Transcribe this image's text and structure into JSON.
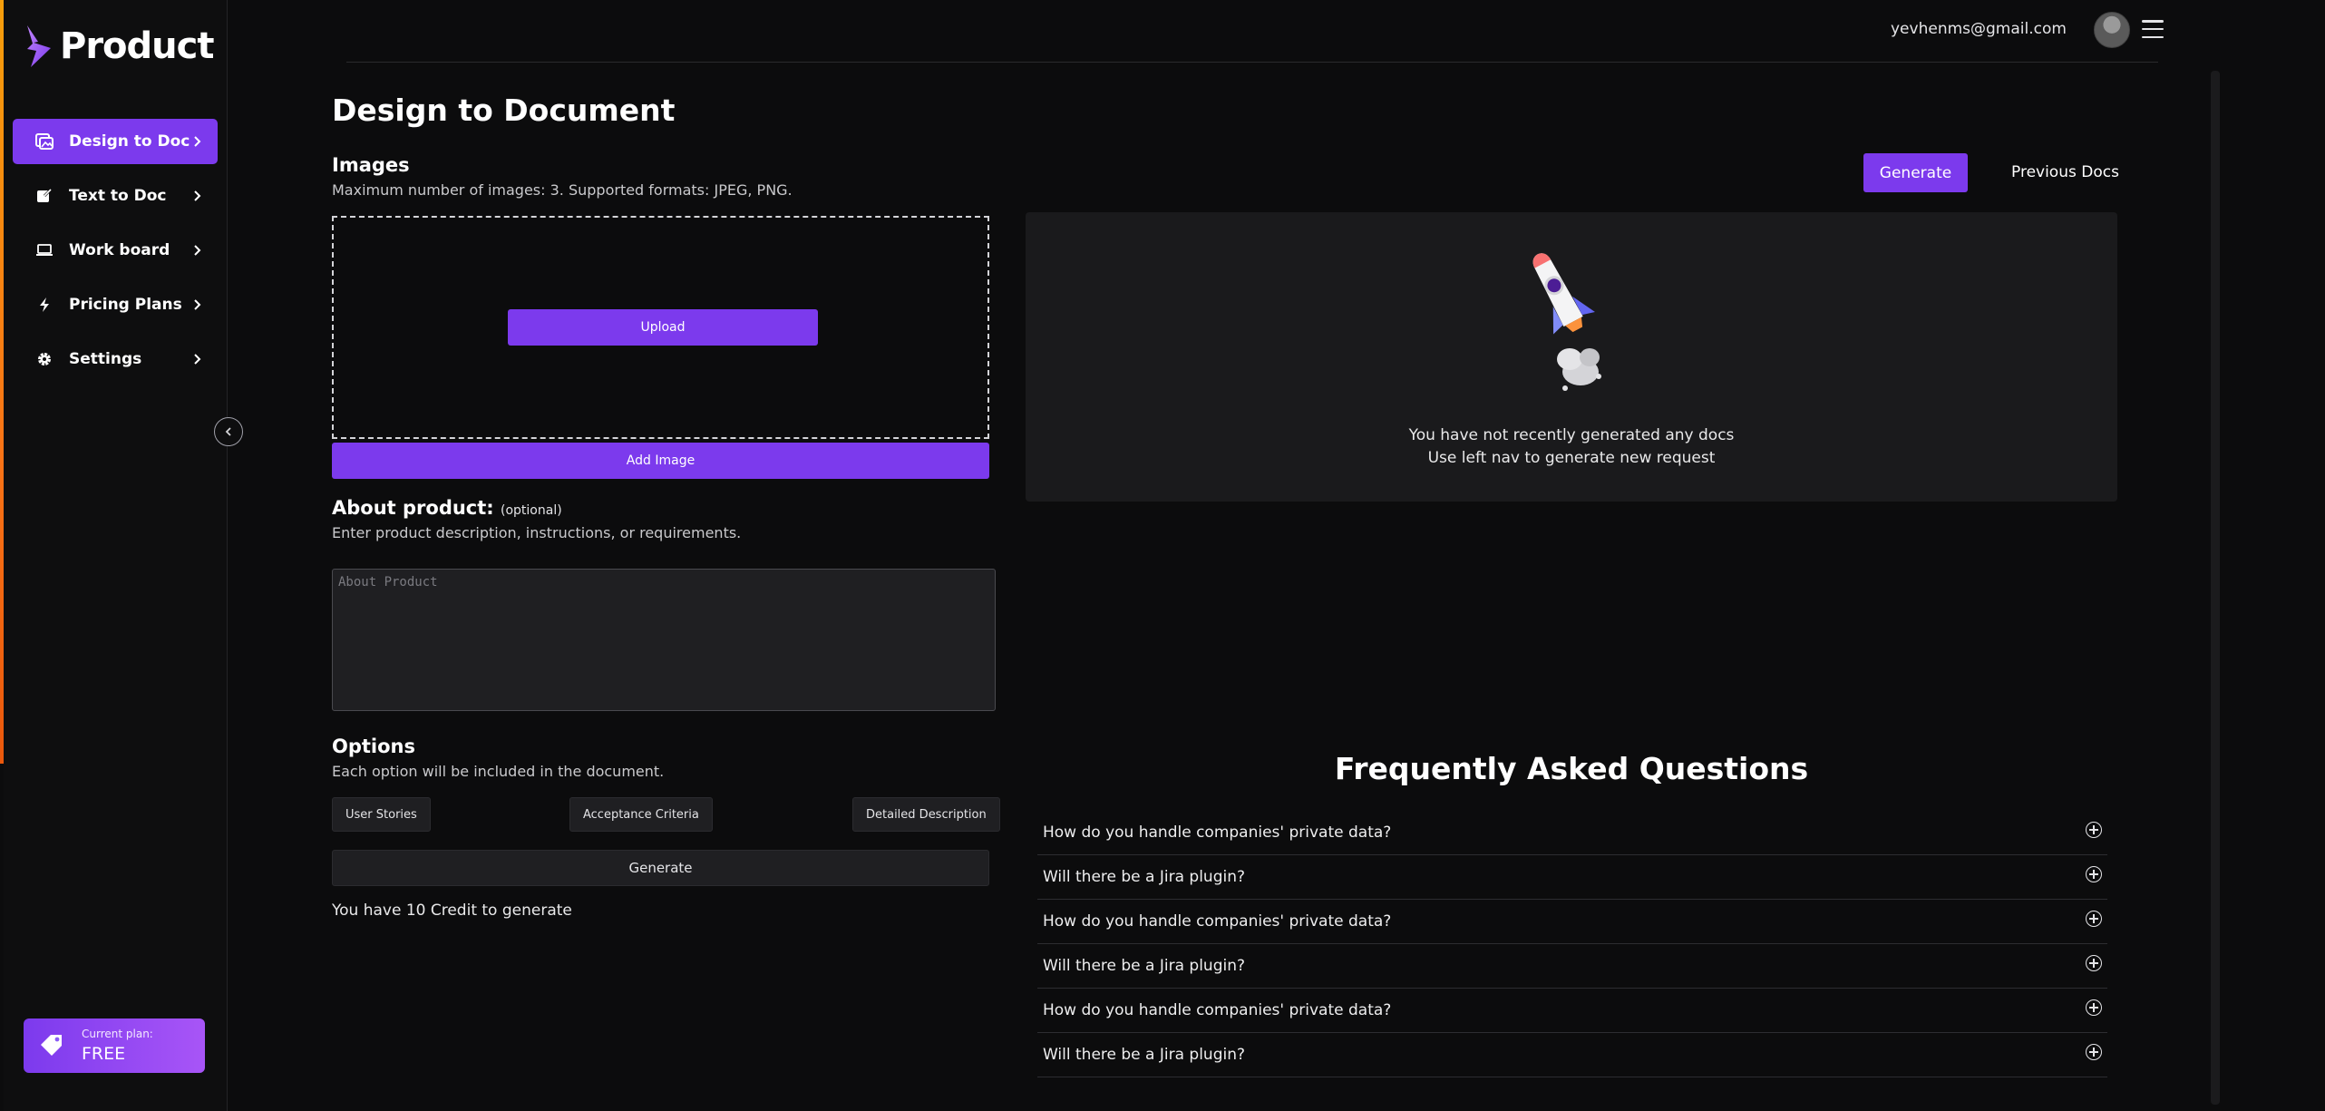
{
  "brand": {
    "name": "Product",
    "accent": "#7c3aed"
  },
  "sidebar": {
    "items": [
      {
        "label": "Design to Doc",
        "icon": "image-doc-icon",
        "active": true
      },
      {
        "label": "Text to Doc",
        "icon": "edit-doc-icon",
        "active": false
      },
      {
        "label": "Work board",
        "icon": "laptop-icon",
        "active": false
      },
      {
        "label": "Pricing Plans",
        "icon": "bolt-icon",
        "active": false
      },
      {
        "label": "Settings",
        "icon": "gear-icon",
        "active": false
      }
    ],
    "plan": {
      "label": "Current plan:",
      "value": "FREE",
      "icon": "tag-icon"
    }
  },
  "header": {
    "email": "yevhenms@gmail.com"
  },
  "main": {
    "title": "Design to Document",
    "images": {
      "title": "Images",
      "subtitle": "Maximum number of images: 3. Supported formats: JPEG, PNG.",
      "upload_label": "Upload",
      "add_image_label": "Add Image"
    },
    "about": {
      "title": "About product:",
      "optional": "(optional)",
      "subtitle": "Enter product description, instructions, or requirements.",
      "placeholder": "About Product"
    },
    "options": {
      "title": "Options",
      "subtitle": "Each option will be included in the document.",
      "chips": [
        "User Stories",
        "Acceptance Criteria",
        "Detailed Description"
      ],
      "generate_label": "Generate"
    },
    "credits": "You have 10 Credit to generate"
  },
  "right": {
    "generate_label": "Generate",
    "previous_docs_label": "Previous Docs",
    "empty": {
      "line1": "You have not recently generated any docs",
      "line2": "Use left nav to generate new request"
    },
    "faq": {
      "title": "Frequently Asked Questions",
      "items": [
        "How do you handle companies' private data?",
        "Will there be a Jira plugin?",
        "How do you handle companies' private data?",
        "Will there be a Jira plugin?",
        "How do you handle companies' private data?",
        "Will there be a Jira plugin?"
      ]
    }
  }
}
